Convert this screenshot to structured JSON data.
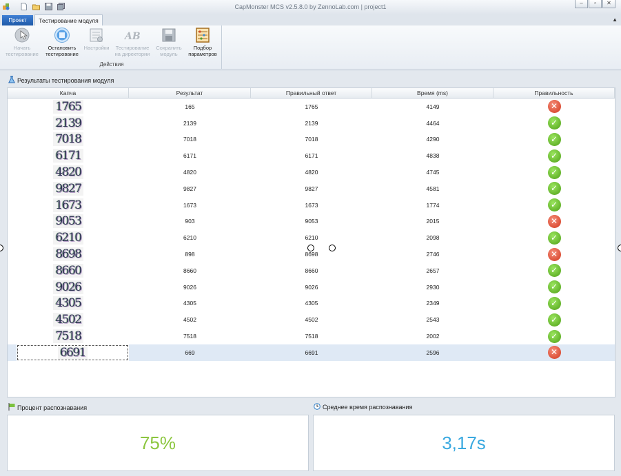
{
  "window": {
    "title": "CapMonster MCS v2.5.8.0 by ZennoLab.com | project1"
  },
  "tabs": {
    "project": "Проект",
    "testing": "Тестирование модуля"
  },
  "ribbon": {
    "buttons": [
      {
        "label1": "Начать",
        "label2": "тестирование",
        "icon": "start-icon",
        "enabled": false
      },
      {
        "label1": "Остановить",
        "label2": "тестирование",
        "icon": "stop-icon",
        "enabled": true
      },
      {
        "label1": "Настройки",
        "label2": "",
        "icon": "settings-icon",
        "enabled": false
      },
      {
        "label1": "Тестирование",
        "label2": "на директории",
        "icon": "directory-test-icon",
        "enabled": false
      },
      {
        "label1": "Сохранить",
        "label2": "модуль",
        "icon": "save-icon",
        "enabled": false
      },
      {
        "label1": "Подбор",
        "label2": "параметров",
        "icon": "abacus-icon",
        "enabled": true
      }
    ],
    "group_label": "Действия"
  },
  "results": {
    "title": "Результаты тестирования модуля",
    "columns": [
      "Капча",
      "Результат",
      "Правильный ответ",
      "Время (ms)",
      "Правильность"
    ],
    "rows": [
      {
        "captcha": "1765",
        "result": "165",
        "answer": "1765",
        "time": "4149",
        "correct": false
      },
      {
        "captcha": "2139",
        "result": "2139",
        "answer": "2139",
        "time": "4464",
        "correct": true
      },
      {
        "captcha": "7018",
        "result": "7018",
        "answer": "7018",
        "time": "4290",
        "correct": true
      },
      {
        "captcha": "6171",
        "result": "6171",
        "answer": "6171",
        "time": "4838",
        "correct": true
      },
      {
        "captcha": "4820",
        "result": "4820",
        "answer": "4820",
        "time": "4745",
        "correct": true
      },
      {
        "captcha": "9827",
        "result": "9827",
        "answer": "9827",
        "time": "4581",
        "correct": true
      },
      {
        "captcha": "1673",
        "result": "1673",
        "answer": "1673",
        "time": "1774",
        "correct": true
      },
      {
        "captcha": "9053",
        "result": "903",
        "answer": "9053",
        "time": "2015",
        "correct": false
      },
      {
        "captcha": "6210",
        "result": "6210",
        "answer": "6210",
        "time": "2098",
        "correct": true
      },
      {
        "captcha": "8698",
        "result": "898",
        "answer": "8698",
        "time": "2746",
        "correct": false
      },
      {
        "captcha": "8660",
        "result": "8660",
        "answer": "8660",
        "time": "2657",
        "correct": true
      },
      {
        "captcha": "9026",
        "result": "9026",
        "answer": "9026",
        "time": "2930",
        "correct": true
      },
      {
        "captcha": "4305",
        "result": "4305",
        "answer": "4305",
        "time": "2349",
        "correct": true
      },
      {
        "captcha": "4502",
        "result": "4502",
        "answer": "4502",
        "time": "2543",
        "correct": true
      },
      {
        "captcha": "7518",
        "result": "7518",
        "answer": "7518",
        "time": "2002",
        "correct": true
      },
      {
        "captcha": "6691",
        "result": "669",
        "answer": "6691",
        "time": "2596",
        "correct": false,
        "selected": true
      }
    ]
  },
  "recognition_percent": {
    "title": "Процент распознавания",
    "value": "75%",
    "color": "#8cc63f"
  },
  "avg_time": {
    "title": "Среднее время распознавания",
    "value": "3,17s",
    "color": "#3aa9e0"
  }
}
